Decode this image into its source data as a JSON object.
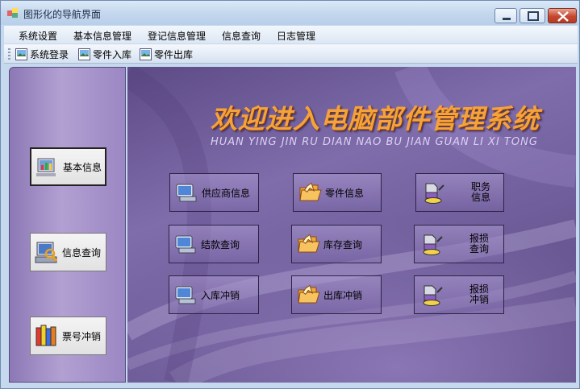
{
  "window": {
    "title": "图形化的导航界面"
  },
  "menu": {
    "items": [
      "系统设置",
      "基本信息管理",
      "登记信息管理",
      "信息查询",
      "日志管理"
    ]
  },
  "toolbar": {
    "buttons": [
      "系统登录",
      "零件入库",
      "零件出库"
    ]
  },
  "sidebar": {
    "buttons": [
      "基本信息",
      "信息查询",
      "票号冲销"
    ],
    "active": "基本信息"
  },
  "banner": {
    "title": "欢迎进入电脑部件管理系统",
    "subtitle": "HUAN YING JIN RU DIAN NAO BU JIAN GUAN LI XI TONG"
  },
  "grid": {
    "col1": [
      "供应商信息",
      "结款查询",
      "入库冲销"
    ],
    "col2": [
      "零件信息",
      "库存查询",
      "出库冲销"
    ],
    "col3": [
      "职务信息",
      "报损查询",
      "报损冲销"
    ]
  },
  "colors": {
    "title_orange": "#f6a23a",
    "panel_purple": "#7f6cab",
    "titlebar_blue": "#c3d6ed"
  }
}
